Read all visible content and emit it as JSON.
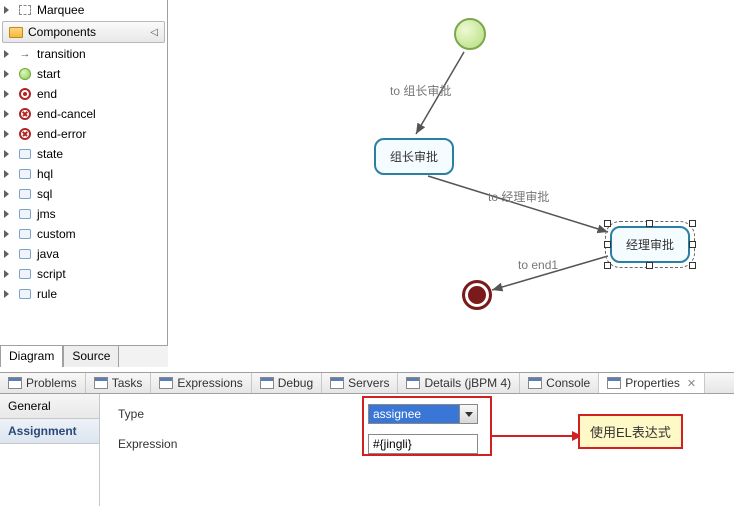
{
  "palette": {
    "marquee": "Marquee",
    "group": "Components",
    "items": [
      {
        "label": "transition",
        "icon": "arrow"
      },
      {
        "label": "start",
        "icon": "green"
      },
      {
        "label": "end",
        "icon": "red"
      },
      {
        "label": "end-cancel",
        "icon": "red-x"
      },
      {
        "label": "end-error",
        "icon": "red-x"
      },
      {
        "label": "state",
        "icon": "sq"
      },
      {
        "label": "hql",
        "icon": "sq"
      },
      {
        "label": "sql",
        "icon": "sq"
      },
      {
        "label": "jms",
        "icon": "sq"
      },
      {
        "label": "custom",
        "icon": "sq"
      },
      {
        "label": "java",
        "icon": "sq"
      },
      {
        "label": "script",
        "icon": "sq"
      },
      {
        "label": "rule",
        "icon": "sq"
      }
    ]
  },
  "flow": {
    "node1": "组长审批",
    "node2": "经理审批",
    "edge1": "to 组长审批",
    "edge2": "to 经理审批",
    "edge3": "to end1"
  },
  "editor_tabs": {
    "t1": "Diagram",
    "t2": "Source"
  },
  "views": [
    {
      "label": "Problems"
    },
    {
      "label": "Tasks"
    },
    {
      "label": "Expressions"
    },
    {
      "label": "Debug"
    },
    {
      "label": "Servers"
    },
    {
      "label": "Details (jBPM 4)"
    },
    {
      "label": "Console"
    },
    {
      "label": "Properties",
      "active": true,
      "closable": true
    }
  ],
  "props": {
    "side": {
      "general": "General",
      "assignment": "Assignment"
    },
    "type_label": "Type",
    "type_value": "assignee",
    "expr_label": "Expression",
    "expr_value": "#{jingli}"
  },
  "callout": "使用EL表达式"
}
